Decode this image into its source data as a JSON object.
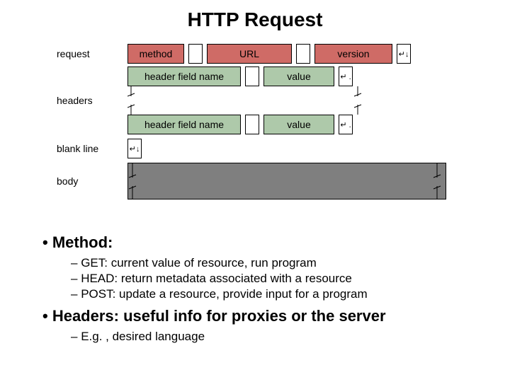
{
  "title": "HTTP Request",
  "labels": {
    "request": "request",
    "headers": "headers",
    "blank": "blank line",
    "body": "body"
  },
  "request_row": {
    "method": "method",
    "url": "URL",
    "version": "version",
    "crlf": "↵↓"
  },
  "header_row": {
    "name": "header field name",
    "value": "value",
    "crlf": "↵ ."
  },
  "blank_row": {
    "crlf": "↵↓"
  },
  "bullets": {
    "method_label": "Method:",
    "methods": [
      "GET: current value of resource, run program",
      "HEAD: return metadata associated with a resource",
      "POST: update a resource, provide input for a program"
    ],
    "headers_label": "Headers: useful info for proxies or the server",
    "headers_items": [
      "E.g. , desired language"
    ]
  }
}
